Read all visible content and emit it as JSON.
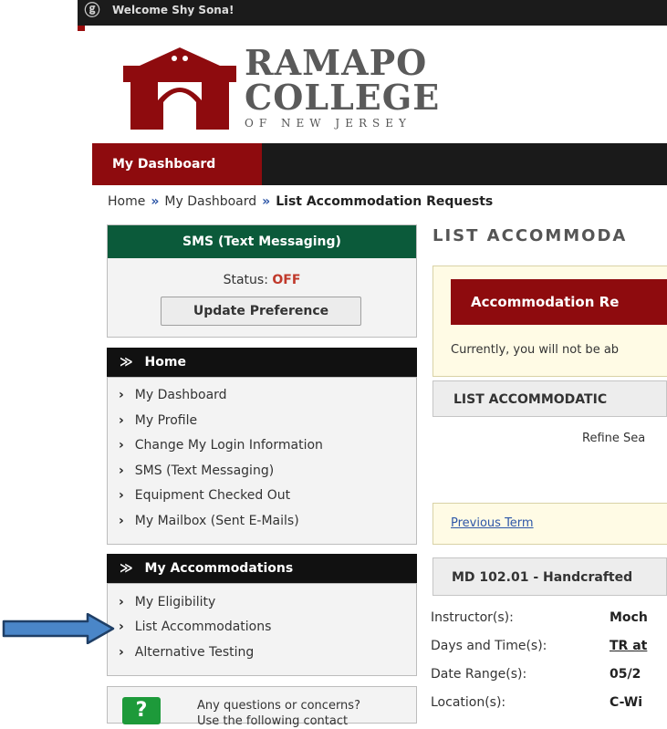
{
  "topbar": {
    "welcome": "Welcome Shy Sona!"
  },
  "logo": {
    "line1": "RAMAPO",
    "line2": "COLLEGE",
    "line3": "OF NEW JERSEY"
  },
  "nav": {
    "active_tab": "My Dashboard"
  },
  "breadcrumb": {
    "home": "Home",
    "sep": "»",
    "dashboard": "My Dashboard",
    "current": "List Accommodation Requests"
  },
  "sms": {
    "title": "SMS (Text Messaging)",
    "status_label": "Status:",
    "status_value": "OFF",
    "button": "Update Preference"
  },
  "home_panel": {
    "title": "Home",
    "items": [
      "My Dashboard",
      "My Profile",
      "Change My Login Information",
      "SMS (Text Messaging)",
      "Equipment Checked Out",
      "My Mailbox (Sent E-Mails)"
    ]
  },
  "accommodations_panel": {
    "title": "My Accommodations",
    "items": [
      "My Eligibility",
      "List Accommodations",
      "Alternative Testing"
    ]
  },
  "help": {
    "icon": "?",
    "text_line1": "Any questions or concerns?",
    "text_line2": "Use the following contact"
  },
  "main": {
    "title": "LIST ACCOMMODA",
    "notice_head": "Accommodation Re",
    "notice_text": "Currently, you will not be ab",
    "list_head": "LIST ACCOMMODATIC",
    "refine": "Refine Sea",
    "previous_term": "Previous Term",
    "course_head": "MD 102.01 - Handcrafted",
    "fields": [
      {
        "label": "Instructor(s):",
        "value": "Moch"
      },
      {
        "label": "Days and Time(s):",
        "value": "TR at"
      },
      {
        "label": "Date Range(s):",
        "value": "05/2"
      },
      {
        "label": "Location(s):",
        "value": "C-Wi"
      }
    ]
  },
  "colors": {
    "brand_red": "#8e0b0e",
    "sms_green": "#0b5a3a",
    "link_blue": "#2e57a8",
    "arrow_blue": "#4a86c8"
  }
}
